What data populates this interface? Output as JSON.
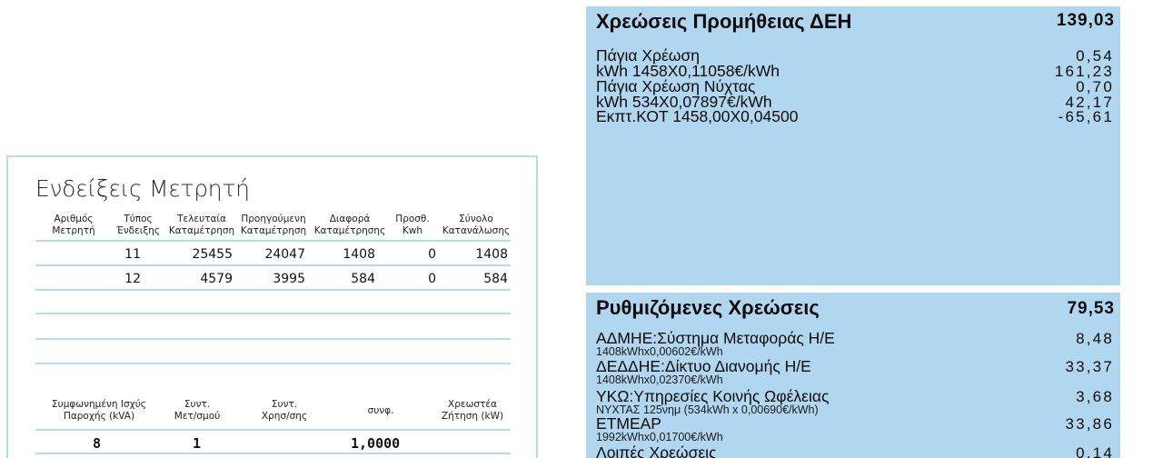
{
  "meter": {
    "title": "Ενδείξεις Μετρητή",
    "headers": [
      [
        "Αριθμός",
        "Μετρητή"
      ],
      [
        "Τύπος",
        "Ένδειξης"
      ],
      [
        "Τελευταία",
        "Καταμέτρηση"
      ],
      [
        "Προηγούμενη",
        "Καταμέτρηση"
      ],
      [
        "Διαφορά",
        "Καταμέτρησης"
      ],
      [
        "Προσθ.",
        "Kwh"
      ],
      [
        "Σύνολο",
        "Κατανάλωσης"
      ]
    ],
    "rows": [
      {
        "type": "11",
        "last": "25455",
        "previous": "24047",
        "diff": "1408",
        "extra": "0",
        "total": "1408"
      },
      {
        "type": "12",
        "last": "4579",
        "previous": "3995",
        "diff": "584",
        "extra": "0",
        "total": "584"
      }
    ],
    "contract_headers": [
      [
        "Συμφωνημένη Ισχύς",
        "Παροχής (kVA)"
      ],
      [
        "Συντ.",
        "Μετ/σμού"
      ],
      [
        "Συντ.",
        "Χρησ/σης"
      ],
      [
        "συνφ."
      ],
      [
        "Χρεωστέα",
        "Ζήτηση (kW)"
      ]
    ],
    "contract_values": {
      "power": "8",
      "meter_factor": "1",
      "usage_factor": "",
      "cosphi": "1,0000",
      "demand": ""
    }
  },
  "supply": {
    "title": "Χρεώσεις Προμήθειας ΔΕΗ",
    "total": "139,03",
    "lines": [
      {
        "label": "Πάγια Χρέωση",
        "value": "0,54"
      },
      {
        "label": "kWh 1458X0,11058€/kWh",
        "value": "161,23"
      },
      {
        "label": "Πάγια Χρέωση Νύχτας",
        "value": "0,70"
      },
      {
        "label": "kWh 534X0,07897€/kWh",
        "value": "42,17"
      },
      {
        "label": "Εκπτ.ΚΟΤ 1458,00X0,04500",
        "value": "-65,61"
      }
    ]
  },
  "regulated": {
    "title": "Ρυθμιζόμενες Χρεώσεις",
    "total": "79,53",
    "lines": [
      {
        "label": "ΑΔΜΗΕ:Σύστημα Μεταφοράς Η/Ε",
        "sub": "1408kWhx0,00602€/kWh",
        "value": "8,48"
      },
      {
        "label": "ΔΕΔΔΗΕ:Δίκτυο Διανομής Η/Ε",
        "sub": "1408kWhx0,02370€/kWh",
        "value": "33,37"
      },
      {
        "label": "ΥΚΩ:Υπηρεσίες Κοινής Ωφέλειας",
        "sub": "ΝΥΧΤΑΣ 125νημ (534kWh x 0,00690€/kWh)",
        "value": "3,68"
      },
      {
        "label": "ΕΤΜΕΑΡ",
        "sub": "1992kWhx0,01700€/kWh",
        "value": "33,86"
      },
      {
        "label": "Λοιπές Χρεώσεις",
        "sub": "",
        "value": "0,14"
      }
    ]
  }
}
